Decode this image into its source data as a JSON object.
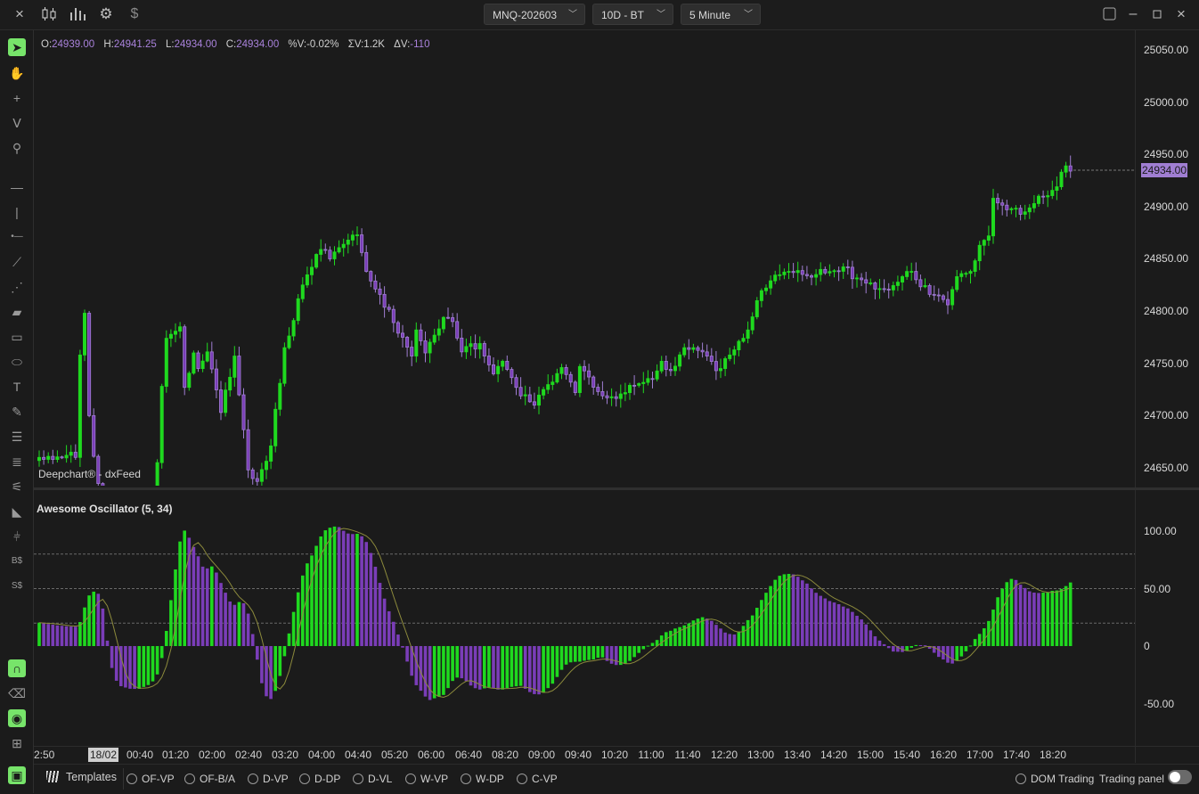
{
  "topbar": {
    "icons": [
      "close-icon",
      "candlestick-icon",
      "bar-chart-icon",
      "gear-icon",
      "dollar-icon"
    ],
    "symbol": "MNQ-202603",
    "range": "10D - BT",
    "interval": "5 Minute",
    "window_icons": [
      "layout-icon",
      "minimize-icon",
      "maximize-icon",
      "close-window-icon"
    ]
  },
  "ohlc": {
    "o_label": "O:",
    "o": "24939.00",
    "h_label": "H:",
    "h": "24941.25",
    "l_label": "L:",
    "l": "24934.00",
    "c_label": "C:",
    "c": "24934.00",
    "pv_label": "%V:",
    "pv": "-0.02%",
    "sv_label": "ΣV:",
    "sv": "1.2K",
    "dv_label": "ΔV:",
    "dv": "-110"
  },
  "watermark": "Deepchart® - dxFeed",
  "indicator": {
    "title": "Awesome Oscillator (5, 34)",
    "axis_labels": [
      "100.00",
      "50.00",
      "0",
      "-50.00"
    ]
  },
  "price_axis": [
    "25050.00",
    "25000.00",
    "24950.00",
    "24900.00",
    "24850.00",
    "24800.00",
    "24750.00",
    "24700.00",
    "24650.00"
  ],
  "last_price": "24934.00",
  "time_axis": [
    "2:50",
    "18/02",
    "00:40",
    "01:20",
    "02:00",
    "02:40",
    "03:20",
    "04:00",
    "04:40",
    "05:20",
    "06:00",
    "06:40",
    "08:20",
    "09:00",
    "09:40",
    "10:20",
    "11:00",
    "11:40",
    "12:20",
    "13:00",
    "13:40",
    "14:20",
    "15:00",
    "15:40",
    "16:20",
    "17:00",
    "17:40",
    "18:20"
  ],
  "sidebar_tools": [
    {
      "name": "select-icon",
      "glyph": "➤",
      "active": true
    },
    {
      "name": "hand-icon",
      "glyph": "✋",
      "active": false
    },
    {
      "name": "crosshair-icon",
      "glyph": "+",
      "active": false
    },
    {
      "name": "magnet-cursor-icon",
      "glyph": "ⴸ",
      "active": false
    },
    {
      "name": "zoom-icon",
      "glyph": "⚲",
      "active": false
    },
    {
      "name": "horizontal-line-icon",
      "glyph": "—",
      "active": false
    },
    {
      "name": "vertical-line-icon",
      "glyph": "|",
      "active": false
    },
    {
      "name": "ray-icon",
      "glyph": "•—",
      "active": false
    },
    {
      "name": "trend-line-icon",
      "glyph": "⟋",
      "active": false
    },
    {
      "name": "channel-icon",
      "glyph": "⋰",
      "active": false
    },
    {
      "name": "ruler-icon",
      "glyph": "▰",
      "active": false
    },
    {
      "name": "rectangle-icon",
      "glyph": "▭",
      "active": false
    },
    {
      "name": "ellipse-icon",
      "glyph": "⬭",
      "active": false
    },
    {
      "name": "text-icon",
      "glyph": "T",
      "active": false
    },
    {
      "name": "pencil-icon",
      "glyph": "✎",
      "active": false
    },
    {
      "name": "lines-3-icon",
      "glyph": "☰",
      "active": false
    },
    {
      "name": "lines-4-icon",
      "glyph": "≣",
      "active": false
    },
    {
      "name": "fib-fan-icon",
      "glyph": "⚟",
      "active": false
    },
    {
      "name": "volume-profile-icon",
      "glyph": "◣",
      "active": false
    },
    {
      "name": "range-icon",
      "glyph": "⫩",
      "active": false
    },
    {
      "name": "buy-order-icon",
      "glyph": "B$",
      "active": false
    },
    {
      "name": "sell-order-icon",
      "glyph": "S$",
      "active": false
    },
    {
      "name": "magnet-icon",
      "glyph": "∩",
      "active": true
    },
    {
      "name": "eraser-icon",
      "glyph": "⌫",
      "active": false
    },
    {
      "name": "eye-icon",
      "glyph": "◉",
      "active": true
    },
    {
      "name": "add-pane-icon",
      "glyph": "⊞",
      "active": false
    },
    {
      "name": "monitor-icon",
      "glyph": "▣",
      "active": true
    }
  ],
  "bottom": {
    "templates": "Templates",
    "presets": [
      "OF-VP",
      "OF-B/A",
      "D-VP",
      "D-DP",
      "D-VL",
      "W-VP",
      "W-DP",
      "C-VP"
    ],
    "dom_trading": "DOM Trading",
    "trading_panel": "Trading panel",
    "trading_panel_on": false
  },
  "colors": {
    "up": "#1fd91f",
    "down": "#7a3db8",
    "down_border": "#a07ed2",
    "signal": "#8c8a3c",
    "accent": "#77e46a",
    "value_text": "#a982db"
  },
  "chart_data": {
    "type": "candlestick",
    "interval": "5 Minute",
    "price_range": [
      24635,
      25060
    ],
    "indicator_range": [
      -80,
      130
    ],
    "indicator_levels": [
      80,
      50,
      20
    ],
    "closes_by_bar": [
      {
        "bar": 0,
        "close": 24660
      },
      {
        "bar": 3,
        "close": 24658
      },
      {
        "bar": 6,
        "close": 24662
      },
      {
        "bar": 8,
        "close": 24660
      },
      {
        "bar": 9,
        "close": 24758
      },
      {
        "bar": 10,
        "close": 24798
      },
      {
        "bar": 11,
        "close": 24700
      },
      {
        "bar": 12,
        "close": 24661
      },
      {
        "bar": 13,
        "close": 24635
      },
      {
        "bar": 16,
        "close": 24615
      },
      {
        "bar": 21,
        "close": 24608
      },
      {
        "bar": 25,
        "close": 24625
      },
      {
        "bar": 26,
        "close": 24655
      },
      {
        "bar": 27,
        "close": 24728
      },
      {
        "bar": 28,
        "close": 24774
      },
      {
        "bar": 31,
        "close": 24785
      },
      {
        "bar": 32,
        "close": 24727
      },
      {
        "bar": 34,
        "close": 24760
      },
      {
        "bar": 35,
        "close": 24745
      },
      {
        "bar": 37,
        "close": 24761
      },
      {
        "bar": 40,
        "close": 24703
      },
      {
        "bar": 43,
        "close": 24757
      },
      {
        "bar": 46,
        "close": 24648
      },
      {
        "bar": 48,
        "close": 24637
      },
      {
        "bar": 51,
        "close": 24671
      },
      {
        "bar": 54,
        "close": 24765
      },
      {
        "bar": 56,
        "close": 24791
      },
      {
        "bar": 58,
        "close": 24825
      },
      {
        "bar": 60,
        "close": 24842
      },
      {
        "bar": 62,
        "close": 24859
      },
      {
        "bar": 64,
        "close": 24850
      },
      {
        "bar": 68,
        "close": 24868
      },
      {
        "bar": 70,
        "close": 24873
      },
      {
        "bar": 72,
        "close": 24838
      },
      {
        "bar": 75,
        "close": 24816
      },
      {
        "bar": 78,
        "close": 24789
      },
      {
        "bar": 80,
        "close": 24775
      },
      {
        "bar": 82,
        "close": 24757
      },
      {
        "bar": 83,
        "close": 24782
      },
      {
        "bar": 85,
        "close": 24760
      },
      {
        "bar": 87,
        "close": 24777
      },
      {
        "bar": 89,
        "close": 24794
      },
      {
        "bar": 91,
        "close": 24790
      },
      {
        "bar": 93,
        "close": 24761
      },
      {
        "bar": 97,
        "close": 24769
      },
      {
        "bar": 98,
        "close": 24757
      },
      {
        "bar": 100,
        "close": 24740
      },
      {
        "bar": 102,
        "close": 24752
      },
      {
        "bar": 105,
        "close": 24727
      },
      {
        "bar": 109,
        "close": 24710
      },
      {
        "bar": 111,
        "close": 24725
      },
      {
        "bar": 115,
        "close": 24746
      },
      {
        "bar": 118,
        "close": 24722
      },
      {
        "bar": 119,
        "close": 24747
      },
      {
        "bar": 123,
        "close": 24723
      },
      {
        "bar": 125,
        "close": 24717
      },
      {
        "bar": 129,
        "close": 24722
      },
      {
        "bar": 130,
        "close": 24729
      },
      {
        "bar": 135,
        "close": 24735
      },
      {
        "bar": 137,
        "close": 24752
      },
      {
        "bar": 139,
        "close": 24743
      },
      {
        "bar": 142,
        "close": 24765
      },
      {
        "bar": 146,
        "close": 24761
      },
      {
        "bar": 149,
        "close": 24743
      },
      {
        "bar": 152,
        "close": 24758
      },
      {
        "bar": 155,
        "close": 24774
      },
      {
        "bar": 156,
        "close": 24782
      },
      {
        "bar": 158,
        "close": 24810
      },
      {
        "bar": 161,
        "close": 24829
      },
      {
        "bar": 165,
        "close": 24838
      },
      {
        "bar": 171,
        "close": 24835
      },
      {
        "bar": 178,
        "close": 24842
      },
      {
        "bar": 179,
        "close": 24831
      },
      {
        "bar": 183,
        "close": 24827
      },
      {
        "bar": 186,
        "close": 24821
      },
      {
        "bar": 190,
        "close": 24833
      },
      {
        "bar": 192,
        "close": 24838
      },
      {
        "bar": 196,
        "close": 24816
      },
      {
        "bar": 200,
        "close": 24806
      },
      {
        "bar": 202,
        "close": 24833
      },
      {
        "bar": 205,
        "close": 24838
      },
      {
        "bar": 207,
        "close": 24863
      },
      {
        "bar": 209,
        "close": 24872
      },
      {
        "bar": 210,
        "close": 24908
      },
      {
        "bar": 213,
        "close": 24897
      },
      {
        "bar": 217,
        "close": 24895
      },
      {
        "bar": 220,
        "close": 24910
      },
      {
        "bar": 224,
        "close": 24919
      },
      {
        "bar": 225,
        "close": 24933
      },
      {
        "bar": 226,
        "close": 24939
      },
      {
        "bar": 227,
        "close": 24934
      }
    ]
  }
}
